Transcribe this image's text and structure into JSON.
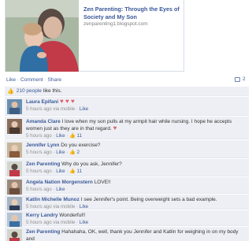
{
  "preview": {
    "title": "Zen Parenting: Through the Eyes of Society and My Son",
    "caption": "zenparenting1.blogspot.com"
  },
  "actions": {
    "like": "Like",
    "sep1": "·",
    "comment": "Comment",
    "sep2": "·",
    "share": "Share",
    "comment_count": "2"
  },
  "likes_bar": {
    "link": "210 people",
    "rest": "like this."
  },
  "comments": [
    {
      "author": "Laura Epifani",
      "text": "",
      "hearts": "♥ ♥ ♥",
      "time": "5 hours ago via mobile",
      "like": "Like",
      "count": ""
    },
    {
      "author": "Amanda Clare",
      "text": "I love when my son pulls at my armpit hair while nursing. I hope he accepts women just as they are in that regard.",
      "hearts": "♥",
      "time": "5 hours ago",
      "like": "Like",
      "count": "11"
    },
    {
      "author": "Jennifer Lynn",
      "text": "Do you exercise?",
      "hearts": "",
      "time": "5 hours ago",
      "like": "Like",
      "count": "2"
    },
    {
      "author": "Zen Parenting",
      "text": "Why do you ask, Jennifer?",
      "hearts": "",
      "time": "5 hours ago",
      "like": "Like",
      "count": "11"
    },
    {
      "author": "Angela Nation Morgenstern",
      "text": "LOVE!!",
      "hearts": "",
      "time": "5 hours ago",
      "like": "Like",
      "count": ""
    },
    {
      "author": "Katlin Michelle Munoz",
      "text": "I see Jennifer's point. Being overweight sets a bad example.",
      "hearts": "",
      "time": "5 hours ago via mobile",
      "like": "Like",
      "count": ""
    },
    {
      "author": "Kerry Landry",
      "text": "Wonderful!!",
      "hearts": "",
      "time": "5 hours ago via mobile",
      "like": "Like",
      "count": ""
    },
    {
      "author": "Zen Parenting",
      "text": "Hahahaha, OK, well, thank you Jennifer and Katlin for weighing in on my body and",
      "hearts": "",
      "time": "",
      "like": "",
      "count": ""
    }
  ]
}
